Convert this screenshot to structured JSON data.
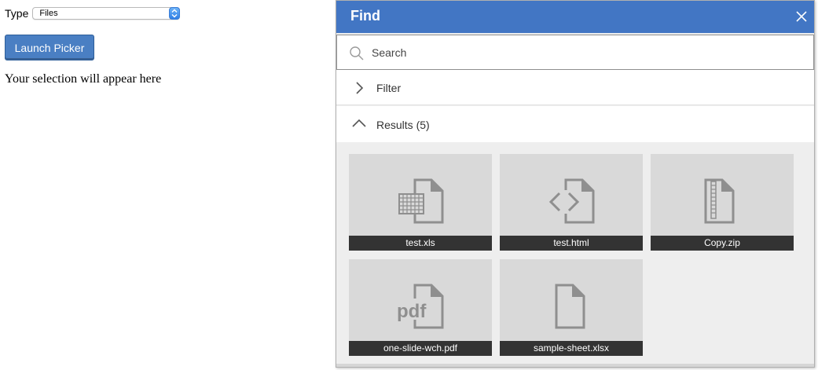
{
  "page": {
    "type_label": "Type",
    "type_select_value": "Files",
    "launch_button_label": "Launch Picker",
    "selection_placeholder": "Your selection will appear here"
  },
  "picker": {
    "title": "Find",
    "close_icon": "close-icon",
    "search": {
      "placeholder": "Search",
      "value": ""
    },
    "filter_label": "Filter",
    "results_label": "Results (5)",
    "files": [
      {
        "name": "test.xls",
        "icon": "spreadsheet-file-icon"
      },
      {
        "name": "test.html",
        "icon": "code-file-icon"
      },
      {
        "name": "Copy.zip",
        "icon": "zip-file-icon"
      },
      {
        "name": "one-slide-wch.pdf",
        "icon": "pdf-file-icon"
      },
      {
        "name": "sample-sheet.xlsx",
        "icon": "generic-file-icon"
      }
    ]
  },
  "colors": {
    "header_blue": "#4276c4",
    "button_blue": "#4a7fc3",
    "tile_bg": "#d9d9d9",
    "tile_label_bg": "#333333",
    "icon_gray": "#8f8f8f"
  }
}
